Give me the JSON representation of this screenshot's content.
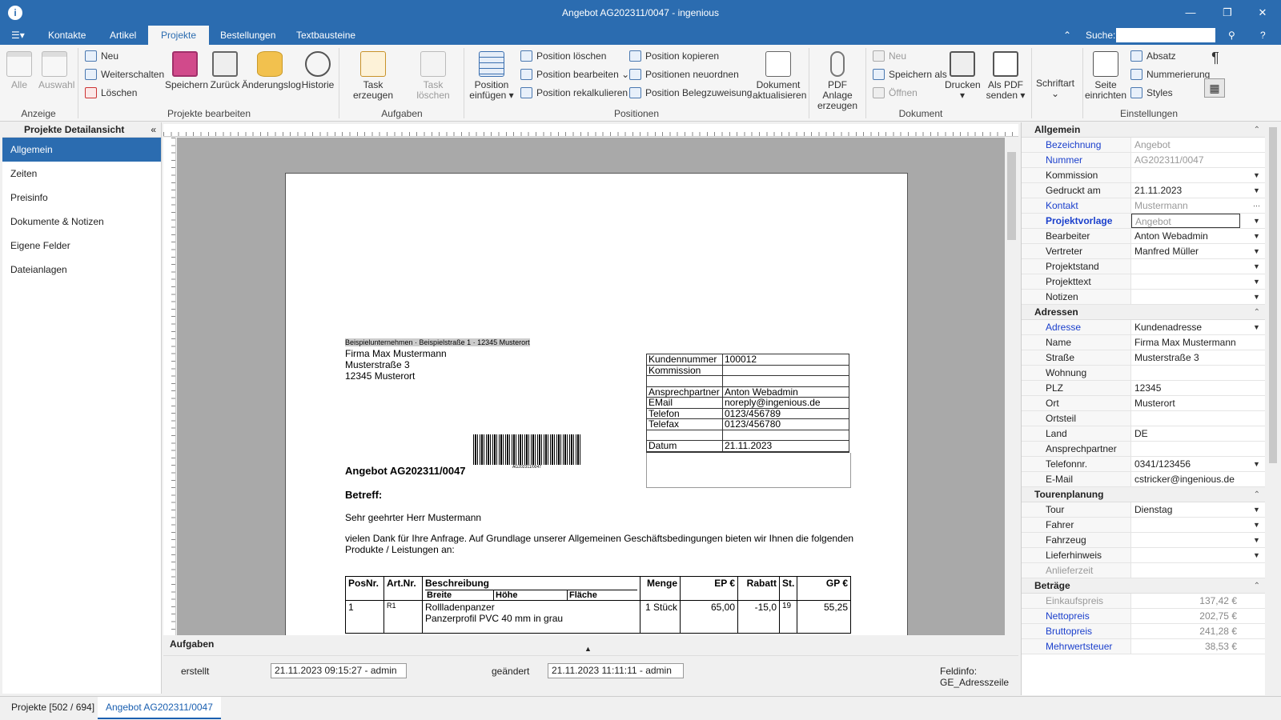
{
  "window": {
    "title": "Angebot AG202311/0047 - ingenious",
    "minimize": "—",
    "maximize": "❐",
    "close": "✕"
  },
  "menu": {
    "tabs": [
      "Kontakte",
      "Artikel",
      "Projekte",
      "Bestellungen",
      "Textbausteine"
    ],
    "active_tab": "Projekte",
    "search_label": "Suche:",
    "search_value": "",
    "help": "?"
  },
  "ribbon": {
    "anzeige": {
      "alle": "Alle",
      "auswahl": "Auswahl",
      "group": "Anzeige"
    },
    "projekte_bearbeiten": {
      "neu": "Neu",
      "weiterschalten": "Weiterschalten",
      "loeschen": "Löschen",
      "speichern": "Speichern",
      "zurueck": "Zurück",
      "aenderungslog": "Änderungslog",
      "historie": "Historie",
      "group": "Projekte bearbeiten"
    },
    "aufgaben": {
      "task_erzeugen": "Task erzeugen",
      "task_loeschen": "Task löschen",
      "group": "Aufgaben"
    },
    "positionen": {
      "position_einfuegen_1": "Position",
      "position_einfuegen_2": "einfügen",
      "position_loeschen": "Position löschen",
      "position_bearbeiten": "Position bearbeiten",
      "position_rekalkulieren": "Position rekalkulieren",
      "position_kopieren": "Position kopieren",
      "positionen_neuordnen": "Positionen neuordnen",
      "position_belegzuweisung": "Position Belegzuweisung",
      "dokument_aktualisieren_1": "Dokument",
      "dokument_aktualisieren_2": "aktualisieren",
      "group": "Positionen"
    },
    "dokument": {
      "pdf_anlage_1": "PDF Anlage",
      "pdf_anlage_2": "erzeugen",
      "neu": "Neu",
      "speichern_als": "Speichern als",
      "oeffnen": "Öffnen",
      "drucken": "Drucken",
      "als_pdf_1": "Als PDF",
      "als_pdf_2": "senden",
      "group": "Dokument"
    },
    "einstellungen": {
      "schriftart": "Schriftart",
      "seite_1": "Seite",
      "seite_2": "einrichten",
      "absatz": "Absatz",
      "nummerierung": "Nummerierung",
      "styles": "Styles",
      "group": "Einstellungen"
    }
  },
  "left_panel": {
    "title": "Projekte Detailansicht",
    "items": [
      "Allgemein",
      "Zeiten",
      "Preisinfo",
      "Dokumente & Notizen",
      "Eigene Felder",
      "Dateianlagen"
    ],
    "active": "Allgemein"
  },
  "document": {
    "sender_line": "Beispielunternehmen · Beispielstraße 1 · 12345 Musterort",
    "recipient": [
      "Firma Max Mustermann",
      "Musterstraße 3",
      "12345 Musterort"
    ],
    "info_rows": [
      {
        "k": "Kundennummer",
        "v": "100012"
      },
      {
        "k": "Kommission",
        "v": ""
      },
      {
        "k": "",
        "v": ""
      },
      {
        "k": "Ansprechpartner",
        "v": "Anton Webadmin"
      },
      {
        "k": "EMail",
        "v": "noreply@ingenious.de"
      },
      {
        "k": "Telefon",
        "v": "0123/456789"
      },
      {
        "k": "Telefax",
        "v": "0123/456780"
      },
      {
        "k": "",
        "v": ""
      },
      {
        "k": "Datum",
        "v": "21.11.2023"
      }
    ],
    "barcode_text": "AG202311/0047",
    "heading": "Angebot AG202311/0047",
    "betreff": "Betreff:",
    "salutation": "Sehr geehrter Herr Mustermann",
    "body_1": "vielen Dank für Ihre Anfrage. Auf Grundlage unserer Allgemeinen Geschäftsbedingungen bieten wir Ihnen die folgenden",
    "body_2": "Produkte / Leistungen an:",
    "table_headers": {
      "posnr": "PosNr.",
      "artnr": "Art.Nr.",
      "beschreibung": "Beschreibung",
      "breite": "Breite",
      "hoehe": "Höhe",
      "flaeche": "Fläche",
      "menge": "Menge",
      "ep": "EP €",
      "rabatt": "Rabatt",
      "st": "St.",
      "gp": "GP €"
    },
    "row1": {
      "posnr": "1",
      "artnr": "R1",
      "line1": "Rollladenpanzer",
      "line2": "Panzerprofil PVC 40 mm in grau",
      "menge": "1 Stück",
      "ep": "65,00",
      "rabatt": "-15,0",
      "st": "19",
      "gp": "55,25"
    }
  },
  "aufgaben_label": "Aufgaben",
  "status": {
    "erstellt_label": "erstellt",
    "erstellt_value": "21.11.2023 09:15:27 - admin",
    "geaendert_label": "geändert",
    "geaendert_value": "21.11.2023 11:11:11 - admin",
    "feldinfo": "Feldinfo: GE_Adresszeile"
  },
  "properties": {
    "allgemein": {
      "title": "Allgemein",
      "rows": [
        {
          "k": "Bezeichnung",
          "v": "Angebot"
        },
        {
          "k": "Nummer",
          "v": "AG202311/0047"
        },
        {
          "k": "Kommission",
          "v": ""
        },
        {
          "k": "Gedruckt am",
          "v": "21.11.2023"
        },
        {
          "k": "Kontakt",
          "v": "Mustermann"
        },
        {
          "k": "Projektvorlage",
          "v": "Angebot"
        },
        {
          "k": "Bearbeiter",
          "v": "Anton Webadmin"
        },
        {
          "k": "Vertreter",
          "v": "Manfred Müller"
        },
        {
          "k": "Projektstand",
          "v": ""
        },
        {
          "k": "Projekttext",
          "v": ""
        },
        {
          "k": "Notizen",
          "v": ""
        }
      ]
    },
    "adressen": {
      "title": "Adressen",
      "rows": [
        {
          "k": "Adresse",
          "v": "Kundenadresse"
        },
        {
          "k": "Name",
          "v": "Firma Max Mustermann"
        },
        {
          "k": "Straße",
          "v": "Musterstraße 3"
        },
        {
          "k": "Wohnung",
          "v": ""
        },
        {
          "k": "PLZ",
          "v": "12345"
        },
        {
          "k": "Ort",
          "v": "Musterort"
        },
        {
          "k": "Ortsteil",
          "v": ""
        },
        {
          "k": "Land",
          "v": "DE"
        },
        {
          "k": "Ansprechpartner",
          "v": ""
        },
        {
          "k": "Telefonnr.",
          "v": "0341/123456"
        },
        {
          "k": "E-Mail",
          "v": "cstricker@ingenious.de"
        }
      ]
    },
    "tourenplanung": {
      "title": "Tourenplanung",
      "rows": [
        {
          "k": "Tour",
          "v": "Dienstag"
        },
        {
          "k": "Fahrer",
          "v": ""
        },
        {
          "k": "Fahrzeug",
          "v": ""
        },
        {
          "k": "Lieferhinweis",
          "v": ""
        },
        {
          "k": "Anlieferzeit",
          "v": ""
        }
      ]
    },
    "betraege": {
      "title": "Beträge",
      "rows": [
        {
          "k": "Einkaufspreis",
          "v": "137,42 €"
        },
        {
          "k": "Nettopreis",
          "v": "202,75 €"
        },
        {
          "k": "Bruttopreis",
          "v": "241,28 €"
        },
        {
          "k": "Mehrwertsteuer",
          "v": "38,53 €"
        }
      ]
    }
  },
  "bottom_tabs": {
    "tab1": "Projekte [502 / 694]",
    "tab2": "Angebot AG202311/0047"
  }
}
